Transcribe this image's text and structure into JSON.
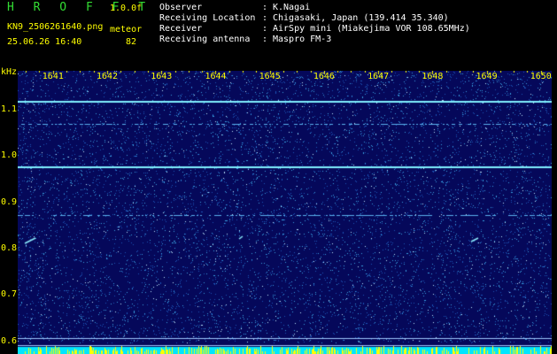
{
  "header": {
    "brand": "H R O F F T",
    "version": "1.0.0f",
    "filename": "KN9_2506261640.png",
    "meteor_label": "meteor",
    "datetime": "25.06.26 16:40",
    "meteor_count": "82",
    "info": [
      {
        "label": "Observer",
        "value": "K.Nagai"
      },
      {
        "label": "Receiving Location",
        "value": "Chigasaki, Japan (139.414 35.340)"
      },
      {
        "label": "Receiver",
        "value": "AirSpy mini (Miakejima VOR 108.65MHz)"
      },
      {
        "label": "Receiving antenna",
        "value": "Maspro FM-3"
      }
    ]
  },
  "plot": {
    "y_title": "kHz",
    "y_ticks": [
      "1.1",
      "1.0",
      "0.9",
      "0.8",
      "0.7",
      "0.6"
    ],
    "y_tick_values": [
      1.1,
      1.0,
      0.9,
      0.8,
      0.7,
      0.6
    ],
    "y_range": [
      0.575,
      1.185
    ],
    "x_ticks": [
      "1641",
      "1642",
      "1643",
      "1644",
      "1645",
      "1646",
      "1647",
      "1648",
      "1649",
      "1650"
    ],
    "x_tick_values": [
      1641,
      1642,
      1643,
      1644,
      1645,
      1646,
      1647,
      1648,
      1649,
      1650
    ],
    "x_range": [
      1640.35,
      1650.2
    ],
    "carrier_lines_khz": [
      1.12,
      0.98,
      0.61,
      0.595
    ],
    "colors": {
      "background": "#05085a",
      "noise": "#3aa0e0",
      "carrier": "#80f0ff",
      "bottom_bar": "#00e5ff",
      "bottom_spikes": "#ffff00",
      "labels": "#ffff00"
    }
  }
}
